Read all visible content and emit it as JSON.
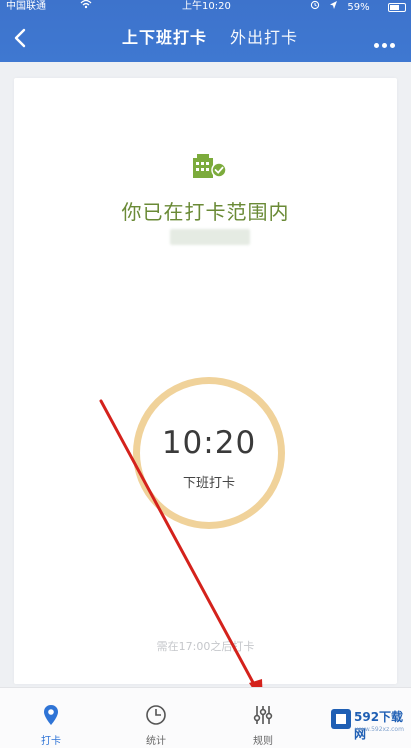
{
  "status_bar": {
    "carrier": "中国联通",
    "time": "上午10:20",
    "battery": "59%"
  },
  "nav": {
    "tabs": [
      {
        "label": "上下班打卡",
        "active": true
      },
      {
        "label": "外出打卡",
        "active": false
      }
    ]
  },
  "checkin": {
    "range_status": "你已在打卡范围内",
    "clock_time": "10:20",
    "clock_label": "下班打卡",
    "hint": "需在17:00之后打卡"
  },
  "bottom_tabs": [
    {
      "label": "打卡",
      "icon": "location-pin-icon",
      "active": true
    },
    {
      "label": "统计",
      "icon": "clock-icon",
      "active": false
    },
    {
      "label": "规则",
      "icon": "sliders-icon",
      "active": false
    }
  ],
  "watermark": {
    "title": "592下载网",
    "subtitle": "www.592xz.com"
  },
  "colors": {
    "brand_blue": "#3d73cc",
    "ring": "#f0d29a",
    "range_green": "#6a8a36",
    "annotation_red": "#d4221c"
  }
}
